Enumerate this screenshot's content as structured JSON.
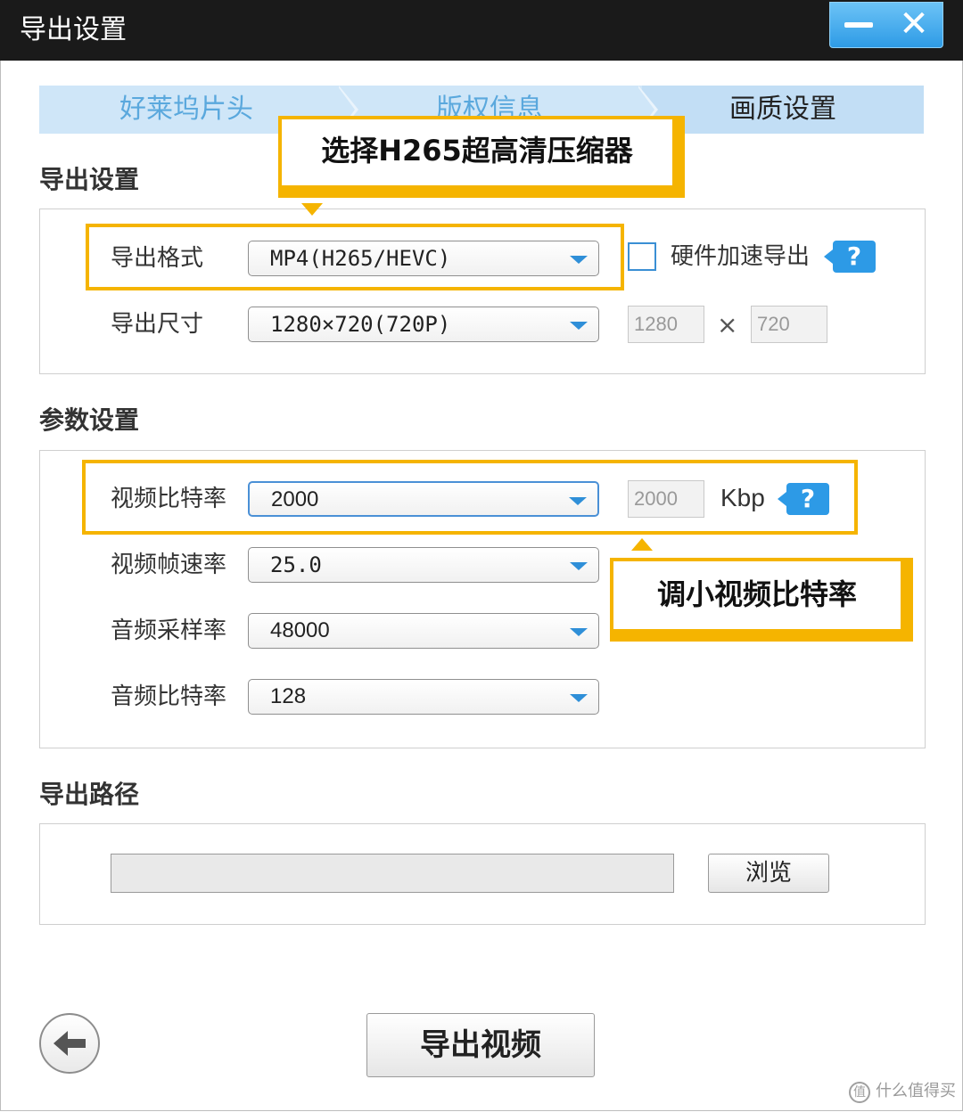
{
  "window": {
    "title": "导出设置",
    "minimize_icon": "minimize-icon",
    "close_icon": "close-icon",
    "close_glyph": "✕"
  },
  "steps": [
    {
      "label": "好莱坞片头",
      "active": false
    },
    {
      "label": "版权信息",
      "active": false
    },
    {
      "label": "画质设置",
      "active": true
    }
  ],
  "export_settings": {
    "section_title": "导出设置",
    "format_label": "导出格式",
    "format_value": "MP4(H265/HEVC)",
    "hw_accel_label": "硬件加速导出",
    "hw_accel_checked": false,
    "help_glyph": "?",
    "size_label": "导出尺寸",
    "size_value": "1280×720(720P)",
    "width_value": "1280",
    "times_sign": "×",
    "height_value": "720"
  },
  "param_settings": {
    "section_title": "参数设置",
    "video_bitrate_label": "视频比特率",
    "video_bitrate_value": "2000",
    "video_bitrate_box": "2000",
    "bitrate_unit": "Kbp",
    "help_glyph": "?",
    "framerate_label": "视频帧速率",
    "framerate_value": "25.0",
    "samplerate_label": "音频采样率",
    "samplerate_value": "48000",
    "audio_bitrate_label": "音频比特率",
    "audio_bitrate_value": "128"
  },
  "export_path": {
    "section_title": "导出路径",
    "path_value": "",
    "browse_label": "浏览"
  },
  "callouts": {
    "codec_tip": "选择H265超高清压缩器",
    "bitrate_tip": "调小视频比特率"
  },
  "footer": {
    "back_icon": "arrow-left-icon",
    "export_button": "导出视频"
  },
  "watermark": {
    "logo_glyph": "值",
    "text": "什么值得买"
  },
  "colors": {
    "accent_blue": "#2d9ae6",
    "highlight_yellow": "#f5b400",
    "titlebar": "#1a1a1a"
  }
}
